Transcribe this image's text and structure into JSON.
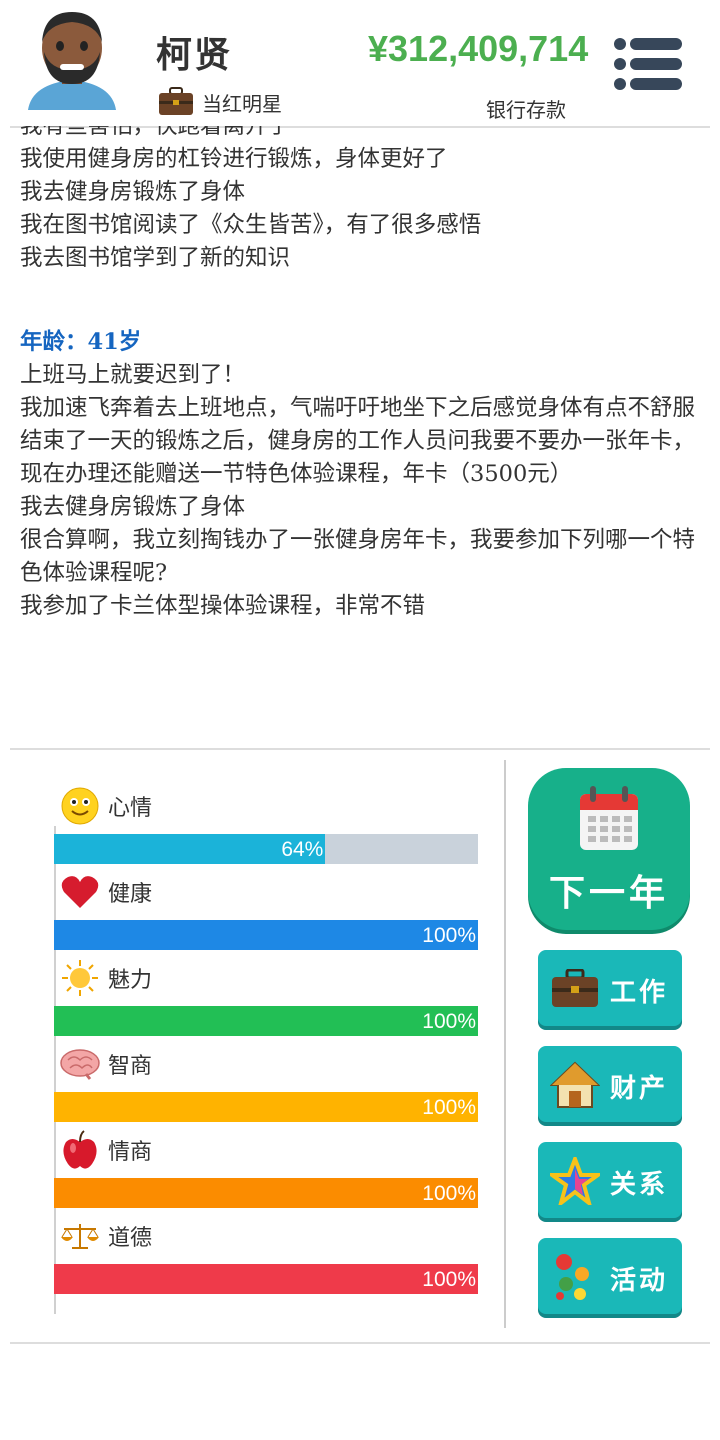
{
  "header": {
    "name": "柯贤",
    "job": "当红明星",
    "money": "¥312,409,714",
    "money_label": "银行存款",
    "icons": {
      "avatar": "man-avatar",
      "job": "briefcase-icon",
      "menu": "menu-icon"
    }
  },
  "log": {
    "prev_lines": [
      "我有些害怕，快跑着离开了",
      "我使用健身房的杠铃进行锻炼，身体更好了",
      "我去健身房锻炼了身体",
      "我在图书馆阅读了《众生皆苦》，有了很多感悟",
      "我去图书馆学到了新的知识"
    ],
    "age_label": "年龄：41岁",
    "lines": [
      "上班马上就要迟到了！",
      "我加速飞奔着去上班地点，气喘吁吁地坐下之后感觉身体有点不舒服",
      "结束了一天的锻炼之后，健身房的工作人员问我要不要办一张年卡，现在办理还能赠送一节特色体验课程，年卡（3500元）",
      "我去健身房锻炼了身体",
      "很合算啊，我立刻掏钱办了一张健身房年卡，我要参加下列哪一个特色体验课程呢?",
      "我参加了卡兰体型操体验课程，非常不错"
    ]
  },
  "stats": [
    {
      "label": "心情",
      "value": 0.64,
      "value_text": "64%",
      "color": "#1bb3d9",
      "icon": "smiley-icon"
    },
    {
      "label": "健康",
      "value": 1.0,
      "value_text": "100%",
      "color": "#1e88e5",
      "icon": "heart-icon"
    },
    {
      "label": "魅力",
      "value": 1.0,
      "value_text": "100%",
      "color": "#22bf55",
      "icon": "sun-icon"
    },
    {
      "label": "智商",
      "value": 1.0,
      "value_text": "100%",
      "color": "#ffb300",
      "icon": "brain-icon"
    },
    {
      "label": "情商",
      "value": 1.0,
      "value_text": "100%",
      "color": "#fb8c00",
      "icon": "apple-icon"
    },
    {
      "label": "道德",
      "value": 1.0,
      "value_text": "100%",
      "color": "#ef3a4a",
      "icon": "scales-icon"
    }
  ],
  "actions": {
    "next_year": "下一年",
    "work": "工作",
    "property": "财产",
    "relations": "关系",
    "activities": "活动",
    "icons": {
      "next": "calendar-icon",
      "work": "briefcase-icon",
      "property": "house-icon",
      "relations": "star-icon",
      "activities": "dots-icon"
    }
  },
  "colors": {
    "money": "#4caf50",
    "age": "#1565c0",
    "next_button": "#17b08a",
    "side_button": "#1ab8b8",
    "bar_track": "#c9d2db"
  }
}
